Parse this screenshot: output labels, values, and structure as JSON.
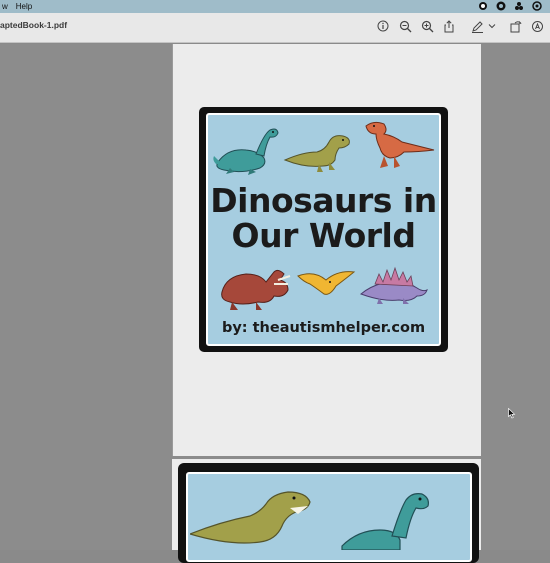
{
  "menubar": {
    "items": [
      "w",
      "Help"
    ]
  },
  "toolbar": {
    "filename": "aptedBook-1.pdf"
  },
  "book": {
    "title_line1": "Dinosaurs in",
    "title_line2": "Our World",
    "byline": "by: theautismhelper.com"
  },
  "icons": {
    "info": "info-icon",
    "zoom_out": "zoom-out-icon",
    "zoom_in": "zoom-in-icon",
    "share": "share-icon",
    "markup": "pen-icon",
    "rotate": "rotate-icon",
    "search": "search-icon"
  }
}
